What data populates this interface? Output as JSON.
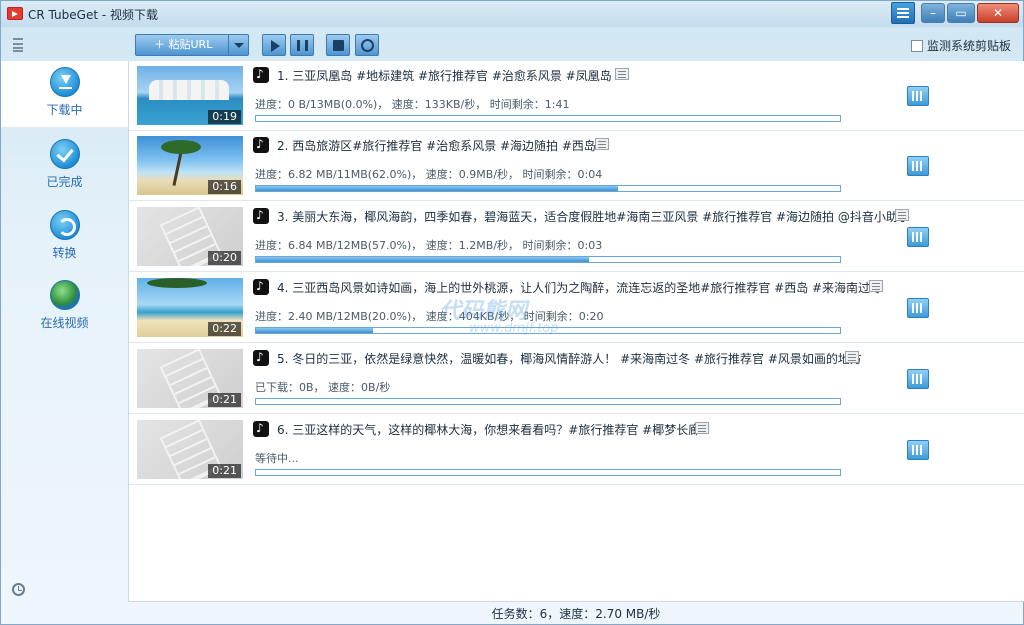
{
  "window": {
    "title": "CR TubeGet - 视频下载"
  },
  "toolbar": {
    "paste_label": "＋ 粘贴URL",
    "monitor_label": "监测系统剪贴板",
    "monitor_checked": false
  },
  "sidebar": {
    "items": [
      {
        "label": "下载中",
        "icon": "download-icon",
        "active": true
      },
      {
        "label": "已完成",
        "icon": "check-icon",
        "active": false
      },
      {
        "label": "转换",
        "icon": "convert-icon",
        "active": false
      },
      {
        "label": "在线视频",
        "icon": "globe-icon",
        "active": false
      }
    ]
  },
  "downloads": [
    {
      "title": "1. 三亚凤凰岛 #地标建筑  #旅行推荐官 #治愈系风景 #凤凰岛",
      "duration": "0:19",
      "status": "进度：0 B/13MB(0.0%)，  速度：133KB/秒，  时间剩余：1:41",
      "progress": 0.0,
      "thumb": "beach1"
    },
    {
      "title": "2. 西岛旅游区#旅行推荐官 #治愈系风景 #海边随拍 #西岛",
      "duration": "0:16",
      "status": "进度：6.82 MB/11MB(62.0%)，  速度：0.9MB/秒，  时间剩余：0:04",
      "progress": 62.0,
      "thumb": "palm"
    },
    {
      "title": "3. 美丽大东海，椰风海韵，四季如春，碧海蓝天，适合度假胜地#海南三亚风景 #旅行推荐官 #海边随拍 @抖音小助手",
      "duration": "0:20",
      "status": "进度：6.84 MB/12MB(57.0%)，  速度：1.2MB/秒，  时间剩余：0:03",
      "progress": 57.0,
      "thumb": "placeholder"
    },
    {
      "title": "4. 三亚西岛风景如诗如画，海上的世外桃源，让人们为之陶醉，流连忘返的圣地#旅行推荐官 #西岛 #来海南过冬",
      "duration": "0:22",
      "status": "进度：2.40 MB/12MB(20.0%)，  速度：404KB/秒，  时间剩余：0:20",
      "progress": 20.0,
      "thumb": "palm2"
    },
    {
      "title": "5. 冬日的三亚，依然是绿意快然，温暖如春，椰海风情醉游人！ #来海南过冬 #旅行推荐官 #风景如画的地方",
      "duration": "0:21",
      "status": "已下载：0B，  速度：0B/秒",
      "progress": 0.0,
      "thumb": "placeholder"
    },
    {
      "title": "6. 三亚这样的天气，这样的椰林大海，你想来看看吗？#旅行推荐官 #椰梦长廊",
      "duration": "0:21",
      "status": "等待中...",
      "progress": 0.0,
      "thumb": "placeholder"
    }
  ],
  "statusbar": {
    "text": "任务数：6，速度：2.70 MB/秒"
  },
  "watermark": {
    "text": "代码熊网",
    "sub": "www.dmjf.top"
  }
}
